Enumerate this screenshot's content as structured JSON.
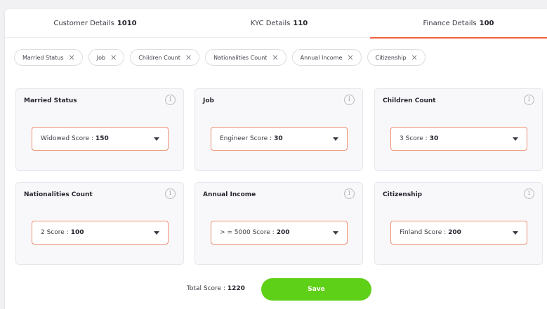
{
  "tabs": [
    {
      "label": "Customer Details",
      "count": "1010",
      "active": false
    },
    {
      "label": "KYC Details",
      "count": "110",
      "active": false
    },
    {
      "label": "Finance Details",
      "count": "100",
      "active": true
    }
  ],
  "chips": [
    {
      "label": "Married Status"
    },
    {
      "label": "Job"
    },
    {
      "label": "Children Count"
    },
    {
      "label": "Nationalities Count"
    },
    {
      "label": "Annual Income"
    },
    {
      "label": "Citizenship"
    }
  ],
  "panels": [
    {
      "title": "Married Status",
      "option": "Widowed",
      "score_label": "Score :",
      "score": "150"
    },
    {
      "title": "Job",
      "option": "Engineer",
      "score_label": "Score :",
      "score": "30"
    },
    {
      "title": "Children Count",
      "option": "3",
      "score_label": "Score :",
      "score": "30"
    },
    {
      "title": "Nationalities Count",
      "option": "2",
      "score_label": "Score :",
      "score": "100"
    },
    {
      "title": "Annual Income",
      "option": "> = 5000",
      "score_label": "Score :",
      "score": "200"
    },
    {
      "title": "Citizenship",
      "option": "Finland",
      "score_label": "Score :",
      "score": "200"
    }
  ],
  "footer": {
    "total_label": "Total Score :",
    "total_value": "1220",
    "save_label": "Save"
  },
  "icons": {
    "chip_remove": "close-icon",
    "panel_info": "info-icon",
    "dropdown": "chevron-down-icon"
  },
  "colors": {
    "accent": "#f0623c",
    "select_border": "#ee8f72",
    "save_button": "#5fd018"
  }
}
